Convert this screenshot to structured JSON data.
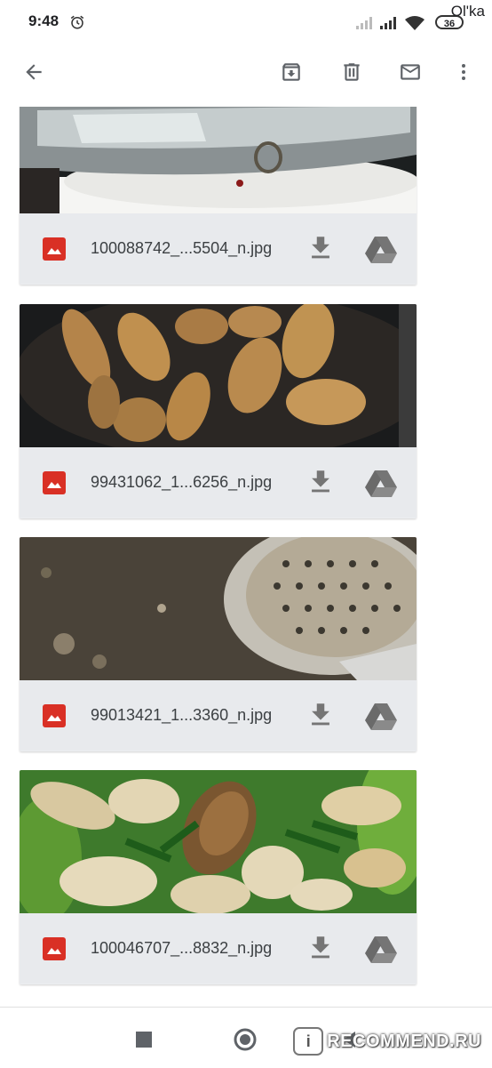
{
  "status": {
    "time": "9:48",
    "battery": "36",
    "user": "Ol'ka"
  },
  "attachments": [
    {
      "filename": "100088742_...5504_n.jpg"
    },
    {
      "filename": "99431062_1...6256_n.jpg"
    },
    {
      "filename": "99013421_1...3360_n.jpg"
    },
    {
      "filename": "100046707_...8832_n.jpg"
    }
  ],
  "watermark": {
    "badge": "i",
    "text": "RECOMMEND.RU"
  },
  "colors": {
    "image_icon": "#d93025",
    "meta_bg": "#e8eaed",
    "icon_grey": "#5f6368"
  },
  "icons": [
    "back-arrow-icon",
    "archive-icon",
    "trash-icon",
    "mail-icon",
    "more-vert-icon",
    "image-icon",
    "download-icon",
    "drive-icon",
    "square-icon",
    "circle-icon",
    "triangle-back-icon"
  ]
}
